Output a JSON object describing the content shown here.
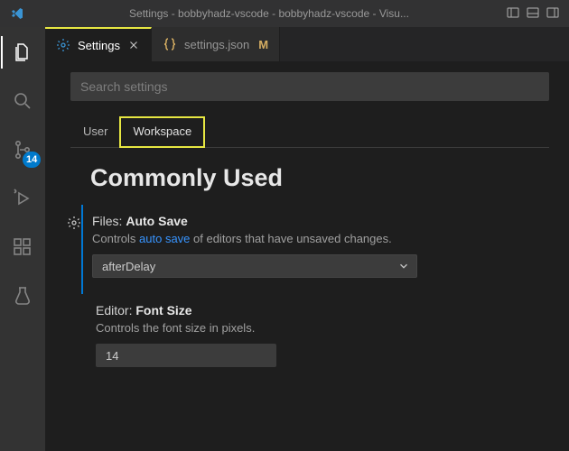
{
  "window": {
    "title": "Settings - bobbyhadz-vscode - bobbyhadz-vscode - Visu..."
  },
  "tabs": {
    "settings": "Settings",
    "json_file": "settings.json",
    "json_modified": "M"
  },
  "search": {
    "placeholder": "Search settings"
  },
  "scopes": {
    "user": "User",
    "workspace": "Workspace"
  },
  "section": {
    "title": "Commonly Used"
  },
  "settings": {
    "autoSave": {
      "category": "Files: ",
      "name": "Auto Save",
      "desc_pre": "Controls ",
      "desc_link": "auto save",
      "desc_post": " of editors that have unsaved changes.",
      "value": "afterDelay"
    },
    "fontSize": {
      "category": "Editor: ",
      "name": "Font Size",
      "desc": "Controls the font size in pixels.",
      "value": "14"
    }
  },
  "sourceControl": {
    "badge": "14"
  }
}
